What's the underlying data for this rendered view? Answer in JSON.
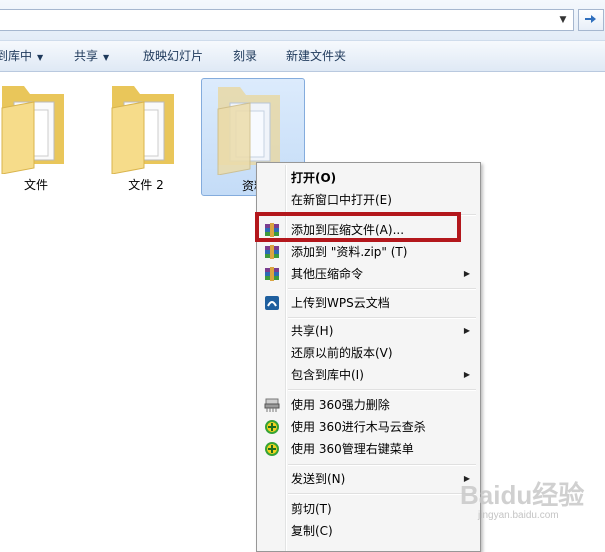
{
  "toolbar": {
    "items": [
      {
        "label": "到库中",
        "dropdown": true
      },
      {
        "label": "共享",
        "dropdown": true
      },
      {
        "label": "放映幻灯片",
        "dropdown": false
      },
      {
        "label": "刻录",
        "dropdown": false
      },
      {
        "label": "新建文件夹",
        "dropdown": false
      }
    ]
  },
  "folders": [
    {
      "label": "文件",
      "selected": false
    },
    {
      "label": "文件 2",
      "selected": false
    },
    {
      "label": "资料",
      "selected": true
    }
  ],
  "context_menu": {
    "items": [
      {
        "label": "打开(O)",
        "bold": true,
        "icon": "",
        "submenu": false
      },
      {
        "label": "在新窗口中打开(E)",
        "icon": "",
        "submenu": false
      },
      {
        "label": "添加到压缩文件(A)...",
        "icon": "winrar-icon",
        "submenu": false,
        "highlighted": true
      },
      {
        "label": "添加到 \"资料.zip\" (T)",
        "icon": "winrar-icon",
        "submenu": false
      },
      {
        "label": "其他压缩命令",
        "icon": "winrar-icon",
        "submenu": true
      },
      {
        "label": "上传到WPS云文档",
        "icon": "wps-cloud-icon",
        "submenu": false
      },
      {
        "label": "共享(H)",
        "icon": "",
        "submenu": true
      },
      {
        "label": "还原以前的版本(V)",
        "icon": "",
        "submenu": false
      },
      {
        "label": "包含到库中(I)",
        "icon": "",
        "submenu": true
      },
      {
        "label": "使用 360强力删除",
        "icon": "shredder-icon",
        "submenu": false
      },
      {
        "label": "使用 360进行木马云查杀",
        "icon": "360-icon",
        "submenu": false
      },
      {
        "label": "使用 360管理右键菜单",
        "icon": "360-icon",
        "submenu": false
      },
      {
        "label": "发送到(N)",
        "icon": "",
        "submenu": true
      },
      {
        "label": "剪切(T)",
        "icon": "",
        "submenu": false
      },
      {
        "label": "复制(C)",
        "icon": "",
        "submenu": false
      }
    ]
  },
  "watermark": {
    "text": "Baidu经验",
    "sub": "jingyan.baidu.com"
  },
  "colors": {
    "highlight_border": "#b3171c",
    "selection": "#c4dcf7"
  }
}
